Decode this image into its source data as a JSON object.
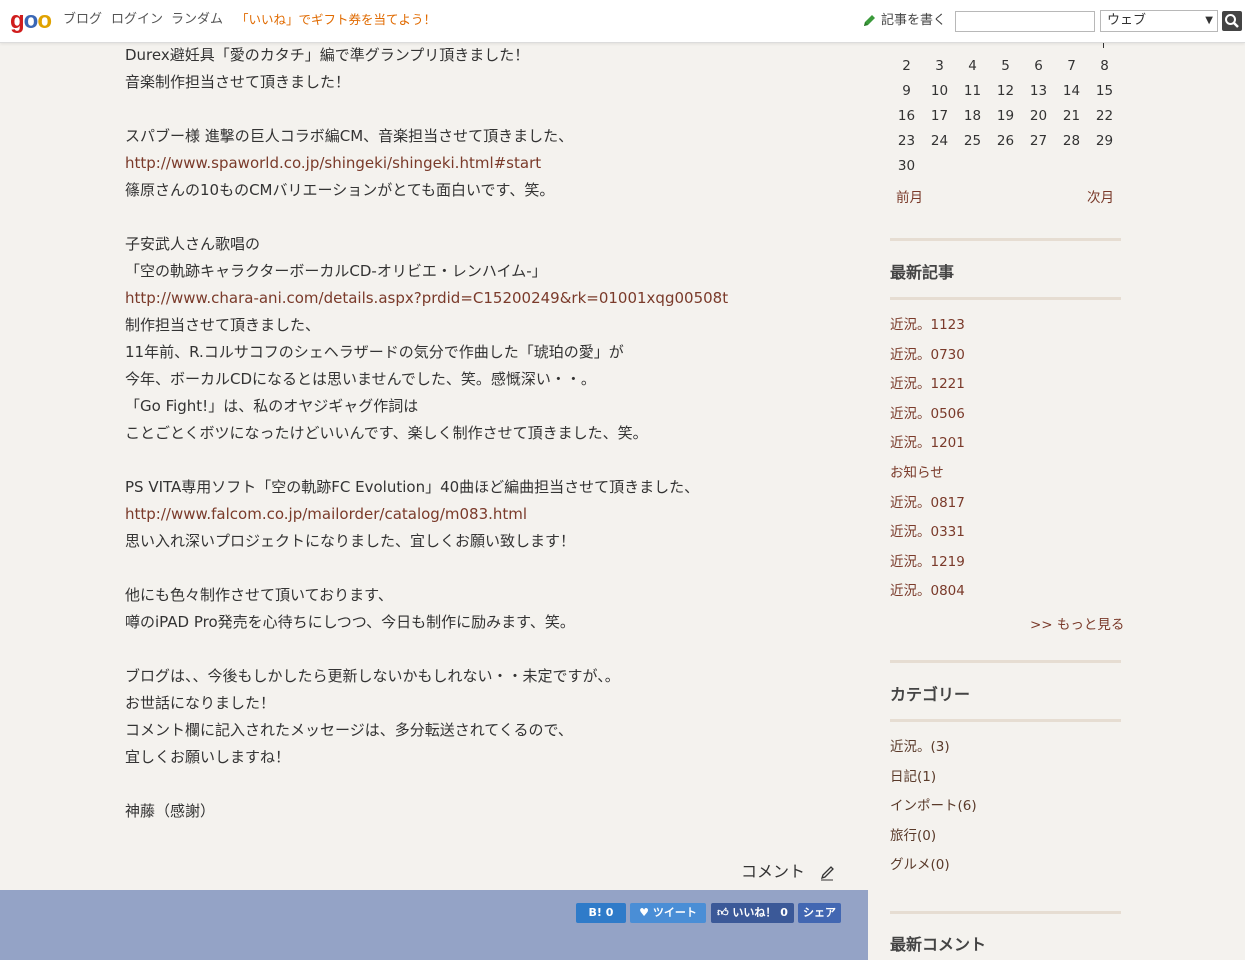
{
  "header": {
    "logo": "goo",
    "nav": [
      "ブログ",
      "ログイン",
      "ランダム"
    ],
    "promo": "「いいね」でギフト券を当てよう！",
    "write_label": "記事を書く",
    "search_placeholder": "",
    "search_scope": "ウェブ"
  },
  "post": {
    "lines": [
      {
        "text": "Durex避妊具「愛のカタチ」編で準グランプリ頂きました！",
        "type": "text"
      },
      {
        "text": "音楽制作担当させて頂きました！",
        "type": "text"
      },
      {
        "text": "",
        "type": "blank"
      },
      {
        "text": "スパブー様 進撃の巨人コラボ編CM、音楽担当させて頂きました、",
        "type": "text"
      },
      {
        "text": "http://www.spaworld.co.jp/shingeki/shingeki.html#start",
        "type": "link"
      },
      {
        "text": "篠原さんの10ものCMバリエーションがとても面白いです、笑。",
        "type": "text"
      },
      {
        "text": "",
        "type": "blank"
      },
      {
        "text": "子安武人さん歌唱の",
        "type": "text"
      },
      {
        "text": "「空の軌跡キャラクターボーカルCD-オリビエ・レンハイム-」",
        "type": "text"
      },
      {
        "text": "http://www.chara-ani.com/details.aspx?prdid=C15200249&rk=01001xqg00508t",
        "type": "link"
      },
      {
        "text": "制作担当させて頂きました、",
        "type": "text"
      },
      {
        "text": "11年前、R.コルサコフのシェヘラザードの気分で作曲した「琥珀の愛」が",
        "type": "text"
      },
      {
        "text": "今年、ボーカルCDになるとは思いませんでした、笑。感慨深い・・。",
        "type": "text"
      },
      {
        "text": "「Go Fight!」は、私のオヤジギャグ作詞は",
        "type": "text"
      },
      {
        "text": "ことごとくボツになったけどいいんです、楽しく制作させて頂きました、笑。",
        "type": "text"
      },
      {
        "text": "",
        "type": "blank"
      },
      {
        "text": "PS VITA専用ソフト「空の軌跡FC Evolution」40曲ほど編曲担当させて頂きました、",
        "type": "text"
      },
      {
        "text": "http://www.falcom.co.jp/mailorder/catalog/m083.html",
        "type": "link"
      },
      {
        "text": "思い入れ深いプロジェクトになりました、宜しくお願い致します！",
        "type": "text"
      },
      {
        "text": "",
        "type": "blank"
      },
      {
        "text": "他にも色々制作させて頂いております、",
        "type": "text"
      },
      {
        "text": "噂のiPAD Pro発売を心待ちにしつつ、今日も制作に励みます、笑。",
        "type": "text"
      },
      {
        "text": "",
        "type": "blank"
      },
      {
        "text": "ブログは、、今後もしかしたら更新しないかもしれない・・未定ですが、。",
        "type": "text"
      },
      {
        "text": "お世話になりました！",
        "type": "text"
      },
      {
        "text": "コメント欄に記入されたメッセージは、多分転送されてくるので、",
        "type": "text"
      },
      {
        "text": "宜しくお願いしますね！",
        "type": "text"
      },
      {
        "text": "",
        "type": "blank"
      },
      {
        "text": "神藤（感謝）",
        "type": "text"
      }
    ],
    "comment_label": "コメント"
  },
  "share": {
    "hatena": "B! 0",
    "tweet": "ツイート",
    "like": "いいね！ 0",
    "facebook": "シェア"
  },
  "calendar": {
    "rows": [
      [
        "2",
        "3",
        "4",
        "5",
        "6",
        "7",
        "8"
      ],
      [
        "9",
        "10",
        "11",
        "12",
        "13",
        "14",
        "15"
      ],
      [
        "16",
        "17",
        "18",
        "19",
        "20",
        "21",
        "22"
      ],
      [
        "23",
        "24",
        "25",
        "26",
        "27",
        "28",
        "29"
      ],
      [
        "30",
        "",
        "",
        "",
        "",
        "",
        ""
      ]
    ],
    "prev": "前月",
    "next": "次月"
  },
  "recent_articles": {
    "title": "最新記事",
    "items": [
      "近況。1123",
      "近況。0730",
      "近況。1221",
      "近況。0506",
      "近況。1201",
      "お知らせ",
      "近況。0817",
      "近況。0331",
      "近況。1219",
      "近況。0804"
    ],
    "more": ">> もっと見る"
  },
  "categories": {
    "title": "カテゴリー",
    "items": [
      "近況。(3)",
      "日記(1)",
      "インポート(6)",
      "旅行(0)",
      "グルメ(0)"
    ]
  },
  "recent_comments": {
    "title": "最新コメント"
  },
  "colors": {
    "accent_link": "#7a3a2a",
    "promo": "#e06a00",
    "band": "#94a3c6"
  }
}
